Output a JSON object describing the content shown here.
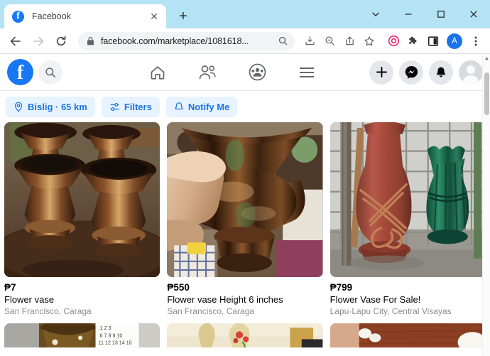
{
  "window": {
    "controls": {
      "tab_search": "tab-search-chevron",
      "minimize": "–",
      "maximize": "□",
      "close": "✕"
    }
  },
  "tabs": [
    {
      "title": "Facebook",
      "favicon": "f",
      "close_label": "✕",
      "active": true
    }
  ],
  "new_tab_label": "+",
  "toolbar": {
    "back_label": "back-arrow",
    "forward_label": "forward-arrow",
    "reload_label": "reload-arrow",
    "url_display": "facebook.com/marketplace/1081618...",
    "url_domain": "facebook.com",
    "url_path": "/marketplace/1081618...",
    "lock_label": "secure-lock",
    "icons": [
      "search-icon",
      "download-icon",
      "zoom-out-icon",
      "share-icon",
      "bookmark-star-icon",
      "record-circle-icon",
      "extensions-puzzle-icon",
      "side-panel-icon"
    ],
    "profile_initial": "A",
    "menu_label": "⋮"
  },
  "facebook_nav": {
    "logo": "f",
    "search_icon": "search-icon",
    "center_tabs": [
      {
        "name": "home",
        "icon": "home-icon"
      },
      {
        "name": "friends",
        "icon": "friends-icon"
      },
      {
        "name": "groups",
        "icon": "groups-icon"
      },
      {
        "name": "menu",
        "icon": "hamburger-menu-icon"
      }
    ],
    "right_actions": [
      {
        "name": "create",
        "icon": "plus-icon"
      },
      {
        "name": "messenger",
        "icon": "messenger-icon"
      },
      {
        "name": "notifications",
        "icon": "bell-icon"
      },
      {
        "name": "account",
        "icon": "avatar-icon"
      }
    ]
  },
  "filters": {
    "chips": [
      {
        "label": "Bislig · 65 km",
        "icon": "location-pin-icon",
        "name": "location-chip"
      },
      {
        "label": "Filters",
        "icon": "sliders-icon",
        "name": "filters-chip"
      },
      {
        "label": "Notify Me",
        "icon": "bell-icon",
        "name": "notify-me-chip"
      }
    ],
    "accent_color": "#1b74e4",
    "chip_bg": "#e7f3ff"
  },
  "listings": [
    {
      "price": "₱7",
      "title": "Flower vase",
      "location": "San Francisco, Caraga",
      "image_alt": "four brown glazed ceramic vases on a dark wooden table"
    },
    {
      "price": "₱550",
      "title": "Flower vase Height 6 inches",
      "location": "San Francisco, Caraga",
      "image_alt": "hand holding a glossy brown ceramic vase indoors"
    },
    {
      "price": "₱799",
      "title": "Flower Vase For Sale!",
      "location": "Lapu-Lapu City, Central Visayas",
      "image_alt": "large red terracotta vase with rope decoration beside a green vase in front of wire mesh fence"
    }
  ],
  "next_row_previews": [
    {
      "image_alt": "brown speckled vase next to a white calendar on a gray wall"
    },
    {
      "image_alt": "pair of tall cream vases with red floral pattern on a table"
    },
    {
      "image_alt": "white ceramic pieces on a reddish wooden surface"
    }
  ],
  "scrollbar": {
    "visible": true,
    "thumb_position": "near-top"
  }
}
